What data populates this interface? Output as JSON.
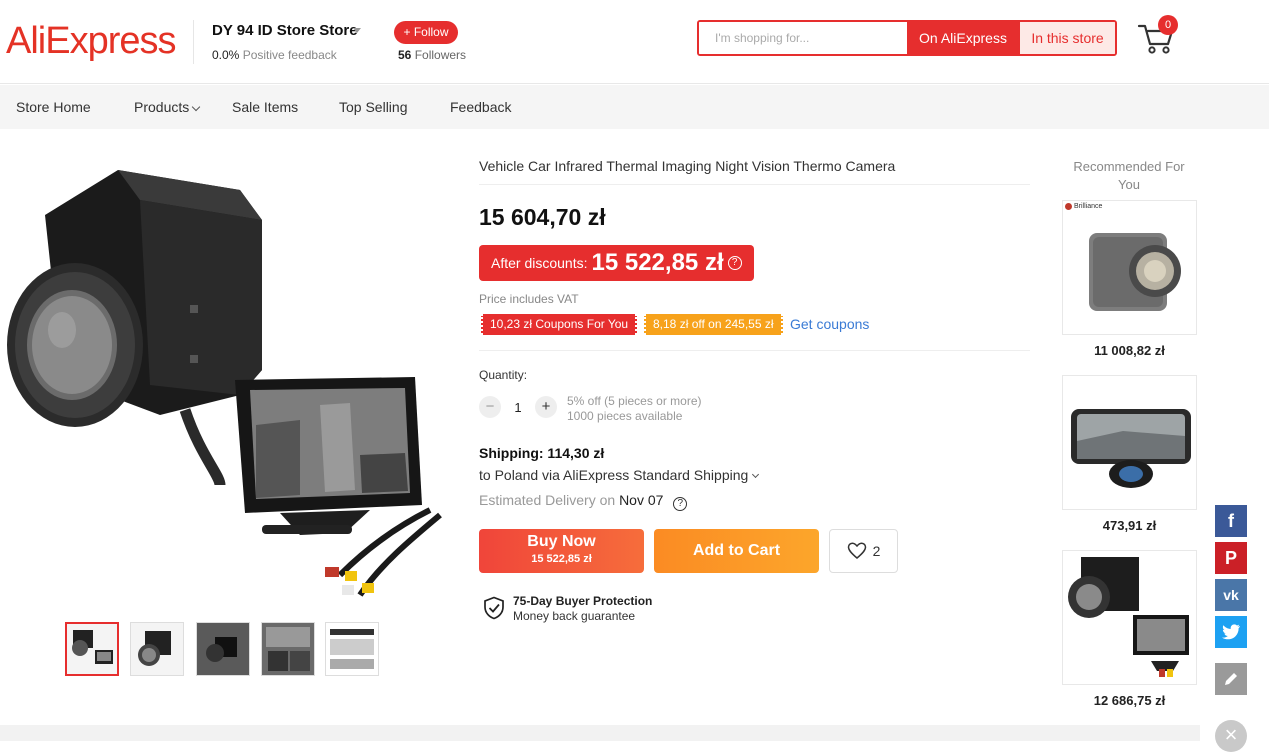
{
  "header": {
    "logo": "AliExpress",
    "store_name": "DY 94 ID Store Store",
    "feedback_value": "0.0%",
    "feedback_label": "Positive feedback",
    "follow_label": "+ Follow",
    "followers_count": "56",
    "followers_label": "Followers",
    "search_placeholder": "I'm shopping for...",
    "search_on_aliexpress": "On AliExpress",
    "search_in_store": "In this store",
    "cart_count": "0"
  },
  "nav": {
    "items": [
      "Store Home",
      "Products",
      "Sale Items",
      "Top Selling",
      "Feedback"
    ]
  },
  "product": {
    "title": "Vehicle Car Infrared Thermal Imaging Night Vision Thermo Camera",
    "price": "15 604,70 zł",
    "discount_label": "After discounts:",
    "discount_price": "15 522,85 zł",
    "vat_note": "Price includes VAT",
    "coupon_1": "10,23 zł Coupons For You",
    "coupon_2": "8,18 zł off on 245,55 zł",
    "get_coupons": "Get coupons",
    "quantity_label": "Quantity:",
    "quantity_value": "1",
    "qty_discount_note": "5% off (5 pieces or more)",
    "qty_available": "1000 pieces available",
    "shipping_label": "Shipping: 114,30 zł",
    "shipping_method": "to Poland via AliExpress Standard Shipping",
    "delivery_label": "Estimated Delivery on",
    "delivery_date": "Nov 07",
    "buy_now_label": "Buy Now",
    "buy_now_price": "15 522,85 zł",
    "add_to_cart_label": "Add to Cart",
    "wishlist_count": "2",
    "protection_title": "75-Day Buyer Protection",
    "protection_subtitle": "Money back guarantee",
    "thumbnail_count": 5
  },
  "recommended": {
    "title": "Recommended For You",
    "items": [
      {
        "price": "11 008,82 zł",
        "brand": "Brilliance"
      },
      {
        "price": "473,91 zł"
      },
      {
        "price": "12 686,75 zł"
      }
    ]
  },
  "social": [
    "facebook-icon",
    "pinterest-icon",
    "vk-icon",
    "twitter-icon",
    "edit-icon"
  ],
  "colors": {
    "brand_red": "#e62e2e",
    "orange": "#fb8b23",
    "link_blue": "#3a7bd5"
  }
}
